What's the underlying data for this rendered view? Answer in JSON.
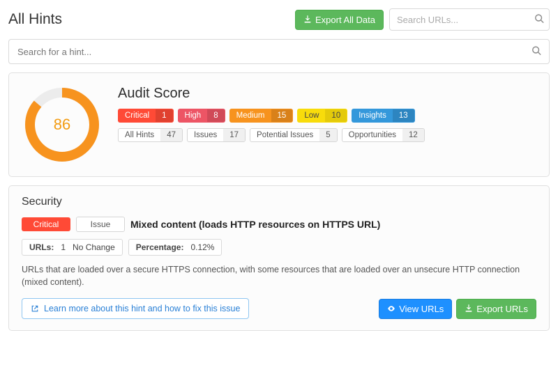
{
  "header": {
    "title": "All Hints",
    "export_all": "Export All Data",
    "url_search_placeholder": "Search URLs..."
  },
  "hint_search_placeholder": "Search for a hint...",
  "score": {
    "title": "Audit Score",
    "value": "86",
    "severity": [
      {
        "label": "Critical",
        "count": "1"
      },
      {
        "label": "High",
        "count": "8"
      },
      {
        "label": "Medium",
        "count": "15"
      },
      {
        "label": "Low",
        "count": "10"
      },
      {
        "label": "Insights",
        "count": "13"
      }
    ],
    "groups": [
      {
        "label": "All Hints",
        "count": "47"
      },
      {
        "label": "Issues",
        "count": "17"
      },
      {
        "label": "Potential Issues",
        "count": "5"
      },
      {
        "label": "Opportunities",
        "count": "12"
      }
    ]
  },
  "section": {
    "title": "Security",
    "hint": {
      "severity": "Critical",
      "type": "Issue",
      "name": "Mixed content (loads HTTP resources on HTTPS URL)",
      "urls_label": "URLs:",
      "urls_value": "1",
      "urls_change": "No Change",
      "pct_label": "Percentage:",
      "pct_value": "0.12%",
      "description": "URLs that are loaded over a secure HTTPS connection, with some resources that are loaded over an unsecure HTTP connection (mixed content).",
      "learn": "Learn more about this hint and how to fix this issue",
      "view_urls": "View URLs",
      "export_urls": "Export URLs"
    }
  }
}
